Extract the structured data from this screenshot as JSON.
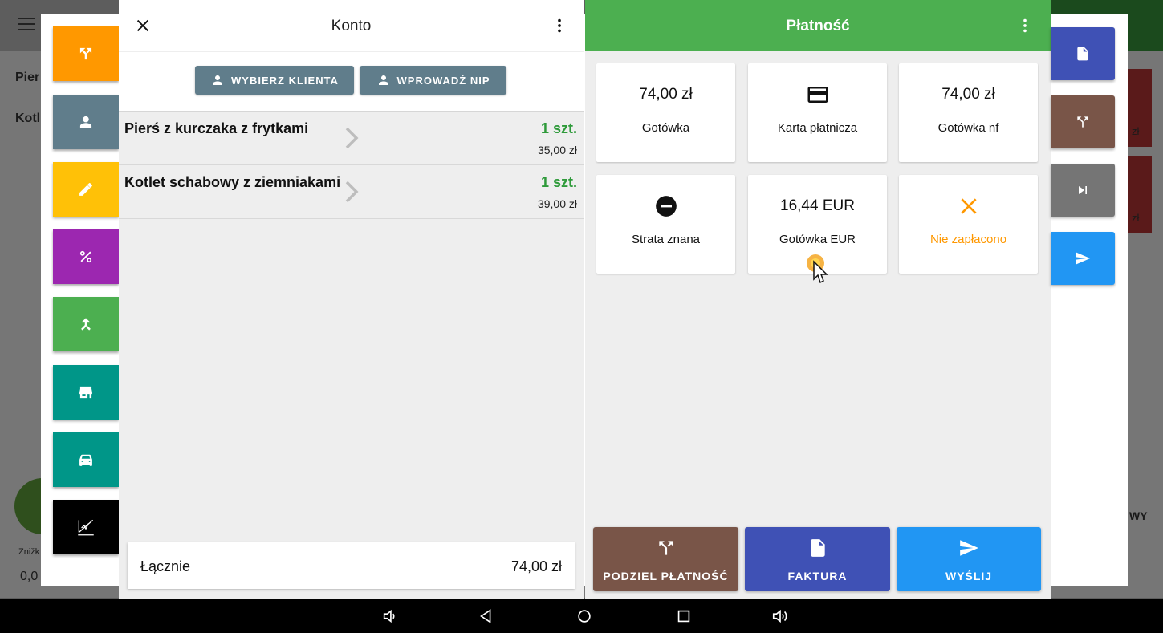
{
  "background": {
    "items": [
      "Pier",
      "Kotl",
      "Znižk",
      "0,0",
      "zł",
      "zł",
      "zł",
      "zł",
      "WY"
    ]
  },
  "konto": {
    "title": "Konto",
    "select_client_label": "WYBIERZ KLIENTA",
    "enter_nip_label": "WPROWADŹ NIP",
    "items": [
      {
        "name": "Pierś z kurczaka z frytkami",
        "qty": "1 szt.",
        "price": "35,00 zł"
      },
      {
        "name": "Kotlet schabowy z ziemniakami",
        "qty": "1 szt.",
        "price": "39,00 zł"
      }
    ],
    "total_label": "Łącznie",
    "total_value": "74,00 zł"
  },
  "payment": {
    "title": "Płatność",
    "methods": [
      {
        "top": "74,00 zł",
        "label": "Gotówka",
        "icon": "none"
      },
      {
        "top": "",
        "label": "Karta płatnicza",
        "icon": "credit-card-icon"
      },
      {
        "top": "74,00 zł",
        "label": "Gotówka nf",
        "icon": "none"
      },
      {
        "top": "",
        "label": "Strata znana",
        "icon": "minus-circle-icon"
      },
      {
        "top": "16,44 EUR",
        "label": "Gotówka EUR",
        "icon": "none"
      },
      {
        "top": "",
        "label": "Nie zapłacono",
        "icon": "close-icon"
      }
    ],
    "split_label": "PODZIEL PŁATNOŚĆ",
    "invoice_label": "FAKTURA",
    "send_label": "WYŚLIJ"
  },
  "colors": {
    "green": "#4caf50",
    "orange": "#ff9800",
    "blue_grey": "#607d8b",
    "yellow": "#ffc107",
    "purple": "#9c27b0",
    "teal": "#009688",
    "brown": "#795548",
    "indigo": "#3f51b5",
    "blue": "#2196f3",
    "grey": "#757575",
    "not_paid": "#ff9800"
  }
}
